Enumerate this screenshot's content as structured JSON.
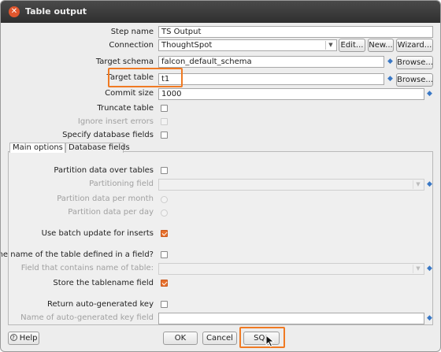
{
  "window": {
    "title": "Table output"
  },
  "fields": {
    "step_name": {
      "label": "Step name",
      "value": "TS Output"
    },
    "connection": {
      "label": "Connection",
      "value": "ThoughtSpot"
    },
    "target_schema": {
      "label": "Target schema",
      "value": "falcon_default_schema"
    },
    "target_table": {
      "label": "Target table",
      "value": "t1"
    },
    "commit_size": {
      "label": "Commit size",
      "value": "1000"
    },
    "truncate_table": {
      "label": "Truncate table",
      "checked": false
    },
    "ignore_insert_errors": {
      "label": "Ignore insert errors",
      "checked": false,
      "disabled": true
    },
    "specify_database_fields": {
      "label": "Specify database fields",
      "checked": false
    }
  },
  "buttons": {
    "edit": "Edit...",
    "new": "New...",
    "wizard": "Wizard...",
    "browse": "Browse...",
    "browse2": "Browse...",
    "help": "Help",
    "ok": "OK",
    "cancel": "Cancel",
    "sql": "SQL"
  },
  "tabs": [
    {
      "label": "Main options",
      "active": true
    },
    {
      "label": "Database fields",
      "active": false
    }
  ],
  "main_options": {
    "partition_over_tables": {
      "label": "Partition data over tables",
      "checked": false
    },
    "partitioning_field": {
      "label": "Partitioning field",
      "value": ""
    },
    "partition_per_month": {
      "label": "Partition data per month"
    },
    "partition_per_day": {
      "label": "Partition data per day"
    },
    "batch_update": {
      "label": "Use batch update for inserts",
      "checked": true
    },
    "table_name_in_field": {
      "label": "Is the name of the table defined in a field?",
      "checked": false
    },
    "field_contains_table_name": {
      "label": "Field that contains name of table:",
      "value": ""
    },
    "store_tablename_field": {
      "label": "Store the tablename field",
      "checked": true
    },
    "return_generated_key": {
      "label": "Return auto-generated key",
      "checked": false
    },
    "generated_key_field": {
      "label": "Name of auto-generated key field",
      "value": ""
    }
  },
  "colors": {
    "accent": "#e76f2b",
    "highlight": "#f07a23",
    "titlebar": "#3a3a3a",
    "variable_icon": "#3a78c5"
  }
}
